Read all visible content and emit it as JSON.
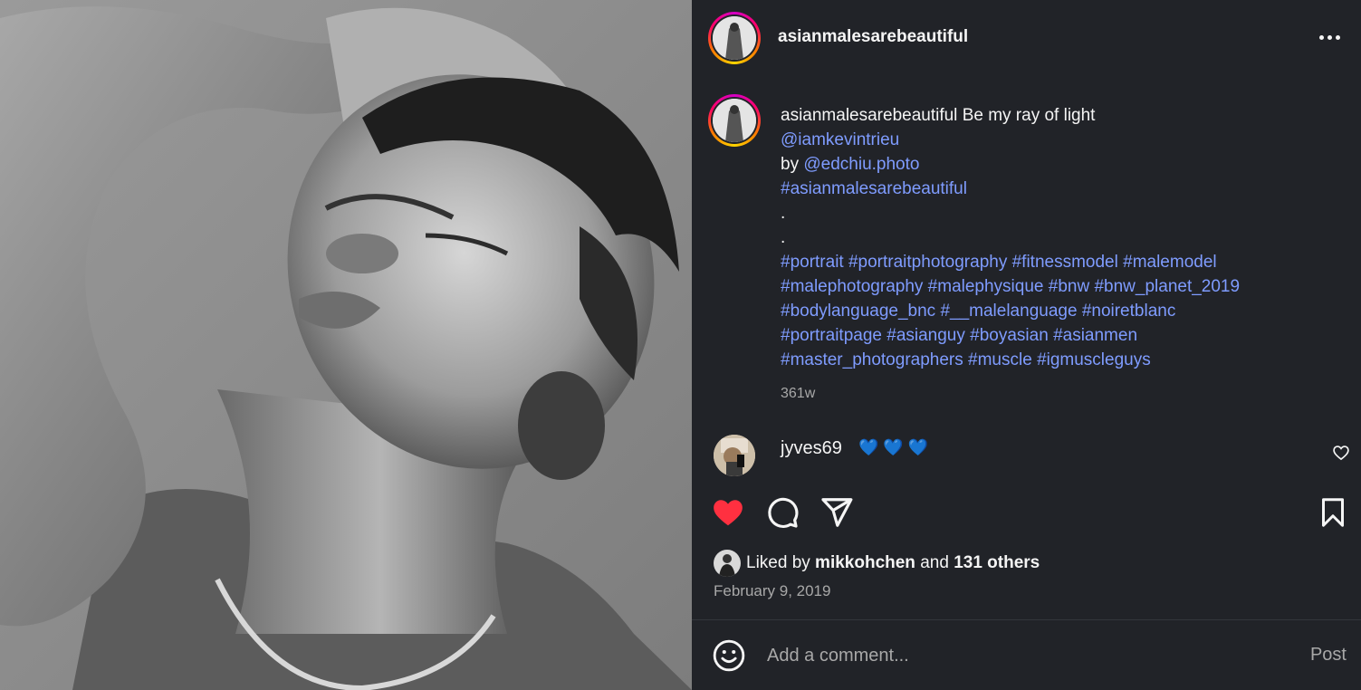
{
  "post": {
    "username": "asianmalesarebeautiful",
    "more_icon": "more-horizontal-icon"
  },
  "caption": {
    "username": "asianmalesarebeautiful",
    "title": "Be my ray of light",
    "mention_model": "@iamkevintrieu",
    "by_prefix": "by",
    "mention_photographer": "@edchiu.photo",
    "main_hashtag": "#asianmalesarebeautiful",
    "dot1": ".",
    "dot2": ".",
    "hashtag_lines": [
      [
        "#portrait",
        "#portraitphotography",
        "#fitnessmodel",
        "#malemodel"
      ],
      [
        "#malephotography",
        "#malephysique",
        "#bnw",
        "#bnw_planet_2019"
      ],
      [
        "#bodylanguage_bnc",
        "#__malelanguage",
        "#noiretblanc"
      ],
      [
        "#portraitpage",
        "#asianguy",
        "#boyasian",
        "#asianmen"
      ],
      [
        "#master_photographers",
        "#muscle",
        "#igmuscleguys"
      ]
    ],
    "time": "361w"
  },
  "comment": {
    "username": "jyves69",
    "text": "💙 💙 💙"
  },
  "actions": {
    "like_icon": "heart-filled-icon",
    "comment_icon": "comment-icon",
    "share_icon": "send-icon",
    "save_icon": "bookmark-icon"
  },
  "likes": {
    "prefix": "Liked by ",
    "user": "mikkohchen",
    "middle": " and ",
    "others": "131 others"
  },
  "date": "February 9, 2019",
  "add_comment": {
    "placeholder": "Add a comment...",
    "post_label": "Post"
  },
  "colors": {
    "background": "#212328",
    "link": "#7f9cff",
    "like_red": "#ff3040",
    "muted": "#a8a8a8"
  }
}
